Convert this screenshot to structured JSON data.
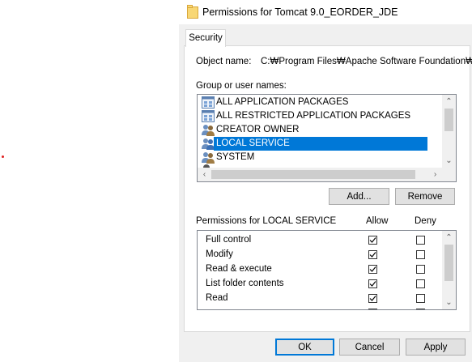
{
  "window": {
    "title": "Permissions for Tomcat 9.0_EORDER_JDE",
    "title_icon": "folder-icon"
  },
  "tabs": [
    {
      "label": "Security",
      "active": true
    }
  ],
  "object_name": {
    "label": "Object name:",
    "value": "C:₩Program Files₩Apache Software Foundation₩"
  },
  "group_list": {
    "label": "Group or user names:",
    "items": [
      {
        "label": "ALL APPLICATION PACKAGES",
        "icon": "app-package-icon",
        "selected": false
      },
      {
        "label": "ALL RESTRICTED APPLICATION PACKAGES",
        "icon": "app-package-icon",
        "selected": false
      },
      {
        "label": "CREATOR OWNER",
        "icon": "users-icon",
        "selected": false
      },
      {
        "label": "LOCAL SERVICE",
        "icon": "users-icon",
        "selected": true
      },
      {
        "label": "SYSTEM",
        "icon": "users-icon",
        "selected": false
      }
    ]
  },
  "buttons": {
    "add": "Add...",
    "remove": "Remove",
    "ok": "OK",
    "cancel": "Cancel",
    "apply": "Apply"
  },
  "permissions": {
    "label": "Permissions for LOCAL SERVICE",
    "allow_header": "Allow",
    "deny_header": "Deny",
    "rows": [
      {
        "name": "Full control",
        "allow": true,
        "deny": false
      },
      {
        "name": "Modify",
        "allow": true,
        "deny": false
      },
      {
        "name": "Read & execute",
        "allow": true,
        "deny": false
      },
      {
        "name": "List folder contents",
        "allow": true,
        "deny": false
      },
      {
        "name": "Read",
        "allow": true,
        "deny": false
      }
    ]
  },
  "colors": {
    "selection": "#0078d7",
    "default_button_border": "#0078d7",
    "dialog_bg": "#f0f0f0"
  }
}
